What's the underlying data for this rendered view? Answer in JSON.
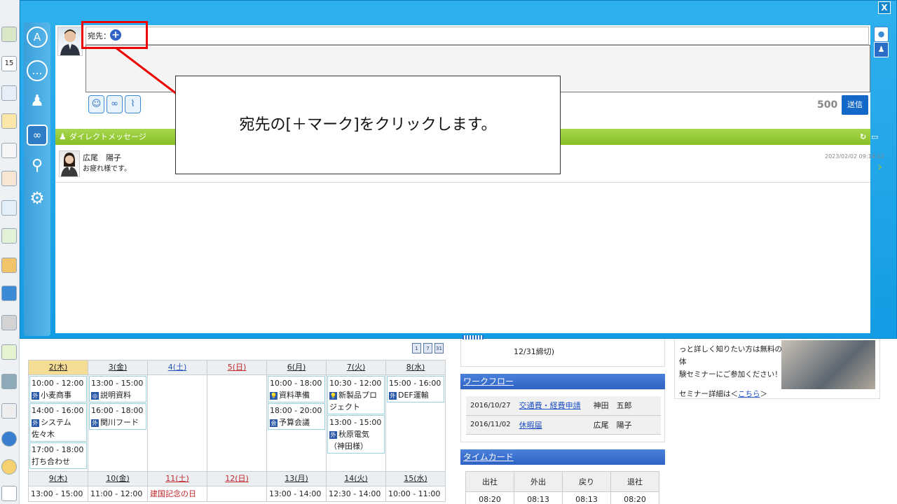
{
  "window": {
    "close_label": "X"
  },
  "compose": {
    "to_label": "宛先：",
    "add_label": "+",
    "counter": "500",
    "send_label": "送信"
  },
  "dm": {
    "section_title": "ダイレクトメッセージ",
    "sender": "広尾　陽子",
    "message": "お疲れ様です。",
    "date": "2023/02/02 09:14:12"
  },
  "callout": {
    "text": "宛先の[＋マーク]をクリックします。"
  },
  "calendar": {
    "week1": [
      {
        "label": "2(木)",
        "kind": "today",
        "events": [
          {
            "time": "10:00 - 12:00",
            "tag": "外",
            "text": "小麦商事"
          },
          {
            "time": "14:00 - 16:00",
            "tag": "外",
            "text": "システム佐々木"
          },
          {
            "time": "17:00 - 18:00",
            "tag": "",
            "text": "打ち合わせ"
          }
        ]
      },
      {
        "label": "3(金)",
        "kind": "",
        "events": [
          {
            "time": "13:00 - 15:00",
            "tag": "◎",
            "text": "説明資料"
          },
          {
            "time": "16:00 - 18:00",
            "tag": "外",
            "text": "関川フード"
          }
        ]
      },
      {
        "label": "4(土)",
        "kind": "sat",
        "events": []
      },
      {
        "label": "5(日)",
        "kind": "sun",
        "events": []
      },
      {
        "label": "6(月)",
        "kind": "",
        "events": [
          {
            "time": "10:00 - 18:00",
            "tag": "💡",
            "text": "資料準備"
          },
          {
            "time": "18:00 - 20:00",
            "tag": "会",
            "text": "予算会議"
          }
        ]
      },
      {
        "label": "7(火)",
        "kind": "",
        "events": [
          {
            "time": "10:30 - 12:00",
            "tag": "💡",
            "text": "新製品プロジェクト"
          },
          {
            "time": "13:00 - 15:00",
            "tag": "外",
            "text": "秋原電気（神田様）"
          }
        ]
      },
      {
        "label": "8(水)",
        "kind": "",
        "events": [
          {
            "time": "15:00 - 16:00",
            "tag": "外",
            "text": "DEF運輸"
          }
        ]
      }
    ],
    "week2": [
      {
        "label": "9(木)",
        "kind": "",
        "line1": "13:00 - 15:00"
      },
      {
        "label": "10(金)",
        "kind": "",
        "line1": "11:00 - 12:00"
      },
      {
        "label": "11(土)",
        "kind": "sun",
        "line1": "建国記念の日"
      },
      {
        "label": "12(日)",
        "kind": "sun",
        "line1": ""
      },
      {
        "label": "13(月)",
        "kind": "",
        "line1": "13:00 - 14:00"
      },
      {
        "label": "14(火)",
        "kind": "",
        "line1": "12:30 - 14:00"
      },
      {
        "label": "15(水)",
        "kind": "",
        "line1": "10:00 - 11:00"
      }
    ]
  },
  "mid": {
    "deadline": "12/31締切)",
    "workflow_title": "ワークフロー",
    "workflow": [
      {
        "date": "2016/10/27",
        "title": "交通費・経費申請",
        "person": "神田　五郎"
      },
      {
        "date": "2016/11/02",
        "title": "休暇届",
        "person": "広尾　陽子"
      }
    ],
    "timecard_title": "タイムカード",
    "timecard_head": [
      "出社",
      "外出",
      "戻り",
      "退社"
    ],
    "timecard_vals": [
      "08:20",
      "08:13",
      "08:13",
      "08:20"
    ]
  },
  "promo": {
    "line1": "っと詳しく知りたい方は無料の体",
    "line2": "験セミナーにご参加ください！",
    "line3": "セミナー詳細は＜",
    "link": "こちら",
    "line3_end": "＞"
  }
}
